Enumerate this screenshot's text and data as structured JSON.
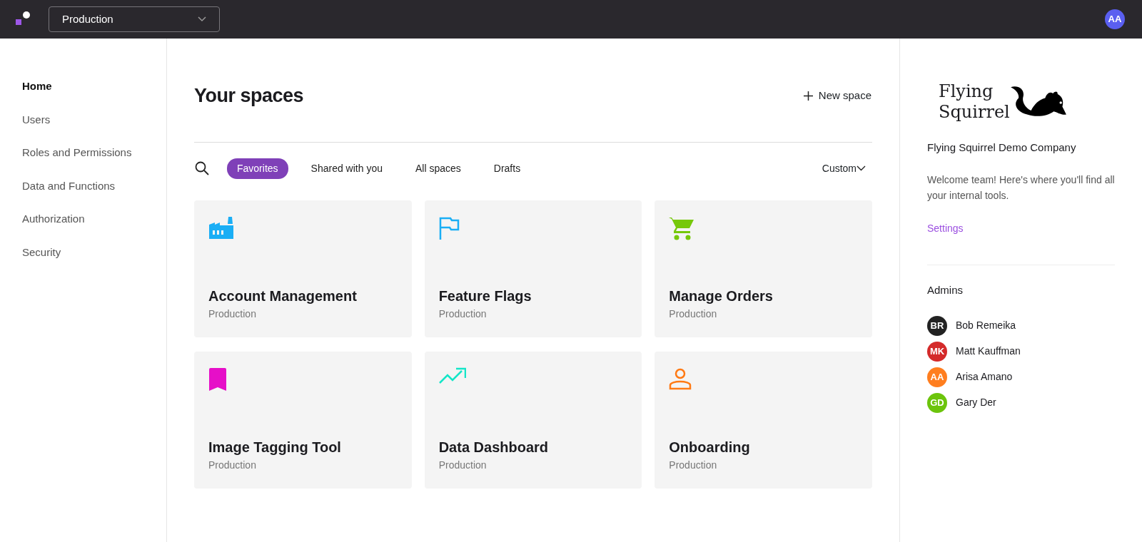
{
  "topbar": {
    "environment": "Production",
    "avatar": "AA"
  },
  "sidebar": {
    "items": [
      {
        "label": "Home",
        "selected": true
      },
      {
        "label": "Users",
        "selected": false
      },
      {
        "label": "Roles and Permissions",
        "selected": false
      },
      {
        "label": "Data and Functions",
        "selected": false
      },
      {
        "label": "Authorization",
        "selected": false
      },
      {
        "label": "Security",
        "selected": false
      }
    ]
  },
  "main": {
    "title": "Your spaces",
    "new_space": "New space",
    "filters": [
      {
        "label": "Favorites",
        "selected": true
      },
      {
        "label": "Shared with you",
        "selected": false
      },
      {
        "label": "All spaces",
        "selected": false
      },
      {
        "label": "Drafts",
        "selected": false
      }
    ],
    "sort": "Custom",
    "spaces": [
      {
        "name": "Account Management",
        "env": "Production",
        "color": "#1aaef5"
      },
      {
        "name": "Feature Flags",
        "env": "Production",
        "color": "#1aaef5"
      },
      {
        "name": "Manage Orders",
        "env": "Production",
        "color": "#76c80a"
      },
      {
        "name": "Image Tagging Tool",
        "env": "Production",
        "color": "#e60fc8"
      },
      {
        "name": "Data Dashboard",
        "env": "Production",
        "color": "#14e6c8"
      },
      {
        "name": "Onboarding",
        "env": "Production",
        "color": "#ff7a14"
      }
    ]
  },
  "panel": {
    "logo_line_1": "Flying",
    "logo_line_2": "Squirrel",
    "company": "Flying Squirrel Demo Company",
    "description": "Welcome team! Here's where you'll find all your internal tools.",
    "settings": "Settings",
    "admins_title": "Admins",
    "admins": [
      {
        "initials": "BR",
        "name": "Bob Remeika",
        "color": "#222222"
      },
      {
        "initials": "MK",
        "name": "Matt Kauffman",
        "color": "#d42a2a"
      },
      {
        "initials": "AA",
        "name": "Arisa Amano",
        "color": "#ff7e1f"
      },
      {
        "initials": "GD",
        "name": "Gary Der",
        "color": "#6cc40c"
      }
    ]
  }
}
